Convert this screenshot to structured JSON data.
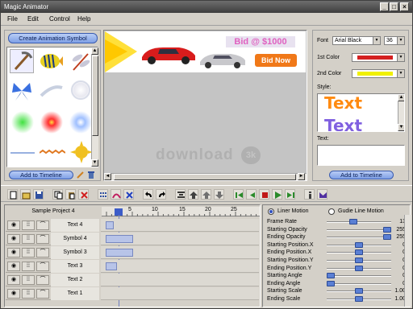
{
  "window": {
    "title": "Magic Animator"
  },
  "menu": {
    "file": "File",
    "edit": "Edit",
    "control": "Control",
    "help": "Help"
  },
  "library": {
    "create_button": "Create Animation Symbol",
    "add_button": "Add to Timeline"
  },
  "canvas": {
    "banner_bid": "Bid @ $1000",
    "banner_button": "Bid Now",
    "watermark": "download",
    "watermark_mark": "3k"
  },
  "text_panel": {
    "font_label": "Font",
    "font_value": "Arial Black",
    "size_value": "36",
    "color1_label": "1st Color",
    "color1": "#d42020",
    "color2_label": "2nd Color",
    "color2": "#f0f000",
    "style_label": "Style:",
    "style_sample": "Text",
    "text_label": "Text:",
    "text_value": "",
    "add_button": "Add to Timeline"
  },
  "timeline": {
    "project_name": "Sample Project 4",
    "ruler_ticks": [
      "5",
      "10",
      "15",
      "20",
      "25"
    ],
    "layers": [
      "Text 4",
      "Symbol 4",
      "Symbol 3",
      "Text 3",
      "Text 2",
      "Text 1"
    ]
  },
  "properties": {
    "motion_liner": "Liner Motion",
    "motion_guide": "Gudie Line Motion",
    "rows": [
      {
        "label": "Frame Rate",
        "value": "13",
        "level": 0.4
      },
      {
        "label": "Starting Opacity",
        "value": "255",
        "level": 1.0
      },
      {
        "label": "Ending Opacity",
        "value": "255",
        "level": 1.0
      },
      {
        "label": "Starting Position.X",
        "value": "0",
        "level": 0.5
      },
      {
        "label": "Ending Position.X",
        "value": "0",
        "level": 0.5
      },
      {
        "label": "Starting Position.Y",
        "value": "0",
        "level": 0.5
      },
      {
        "label": "Ending Position.Y",
        "value": "0",
        "level": 0.5
      },
      {
        "label": "Starting Angle",
        "value": "0",
        "level": 0.0
      },
      {
        "label": "Ending Angle",
        "value": "0",
        "level": 0.0
      },
      {
        "label": "Starting Scale",
        "value": "1.00",
        "level": 0.5
      },
      {
        "label": "Ending Scale",
        "value": "1.00",
        "level": 0.5
      }
    ]
  }
}
